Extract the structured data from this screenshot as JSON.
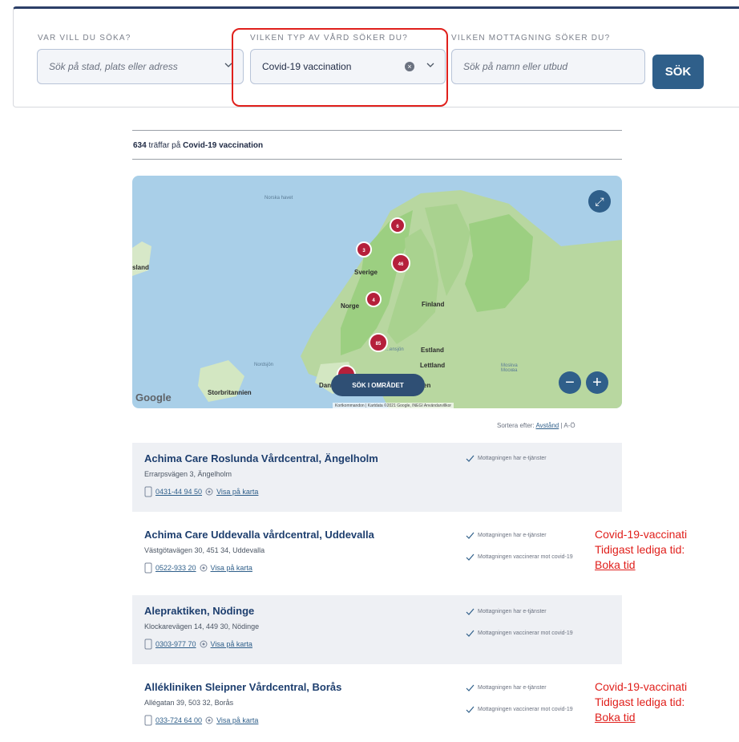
{
  "search": {
    "where_label": "VAR VILL DU SÖKA?",
    "where_placeholder": "Sök på stad, plats eller adress",
    "type_label": "VILKEN TYP AV VÅRD SÖKER DU?",
    "type_value": "Covid-19 vaccination",
    "clinic_label": "VILKEN MOTTAGNING SÖKER DU?",
    "clinic_placeholder": "Sök på namn eller utbud",
    "button": "SÖK"
  },
  "results": {
    "count": "634",
    "mid_text": " träffar på ",
    "query": "Covid-19 vaccination"
  },
  "map": {
    "labels": {
      "norska": "Norska havet",
      "iceland": "sland",
      "sverige": "Sverige",
      "norge": "Norge",
      "finland": "Finland",
      "estland": "Estland",
      "lettland": "Lettland",
      "moskva": "Moskva\nMocква",
      "nordsjon": "Nordsjön",
      "storbritannien": "Storbritannien",
      "danmark": "Dan",
      "sweden_bay": "...ensjön",
      "en": "en"
    },
    "clusters": [
      "6",
      "3",
      "46",
      "4",
      "85"
    ],
    "area_button": "SÖK I OMRÅDET",
    "google": "Google",
    "footer": "Kortkommandon | Kartdata ©2021 Google, INEGI  Användarvillkor"
  },
  "sort": {
    "prefix": "Sortera efter:",
    "distance": "Avstånd",
    "alpha": "A-Ö"
  },
  "listings": [
    {
      "name": "Achima Care Roslunda Vårdcentral, Ängelholm",
      "address": "Errarpsvägen 3, Ängelholm",
      "phone": "0431-44 94 50",
      "map_link": "Visa på karta",
      "feature1": "Mottagningen har e-tjänster"
    },
    {
      "name": "Achima Care Uddevalla vårdcentral, Uddevalla",
      "address": "Västgötavägen 30, 451 34, Uddevalla",
      "phone": "0522-933 20",
      "map_link": "Visa på karta",
      "feature1": "Mottagningen har e-tjänster",
      "feature2": "Mottagningen vaccinerar mot covid-19"
    },
    {
      "name": "Alepraktiken, Nödinge",
      "address": "Klockarevägen 14, 449 30, Nödinge",
      "phone": "0303-977 70",
      "map_link": "Visa på karta",
      "feature1": "Mottagningen har e-tjänster",
      "feature2": "Mottagningen vaccinerar mot covid-19"
    },
    {
      "name": "Allékliniken Sleipner Vårdcentral, Borås",
      "address": "Allégatan 39, 503 32, Borås",
      "phone": "033-724 64 00",
      "map_link": "Visa på karta",
      "feature1": "Mottagningen har e-tjänster",
      "feature2": "Mottagningen vaccinerar mot covid-19"
    }
  ],
  "annotations": [
    {
      "line1": "Covid-19-vaccinati",
      "line2": "Tidigast lediga tid:",
      "link": "Boka tid"
    },
    {
      "line1": "Covid-19-vaccinati",
      "line2": "Tidigast lediga tid:",
      "link": "Boka tid"
    }
  ],
  "colors": {
    "accent": "#2f5f8a",
    "cluster": "#b5203b",
    "annotation": "#e0201c"
  }
}
